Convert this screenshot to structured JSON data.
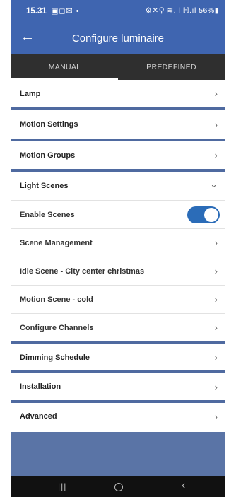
{
  "status_bar": {
    "time": "15.31",
    "left_icons": "▣◻✉ •",
    "right_icons": "⚙✕⚲ ≋.ıl ℍ.ıl 56%▮"
  },
  "app_bar": {
    "back_icon": "arrow-left-icon",
    "back_glyph": "←",
    "title": "Configure luminaire"
  },
  "tabs": [
    {
      "label": "MANUAL",
      "selected": true
    },
    {
      "label": "PREDEFINED",
      "selected": false
    }
  ],
  "rows": {
    "lamp": "Lamp",
    "motion_settings": "Motion Settings",
    "motion_groups": "Motion Groups",
    "light_scenes": "Light Scenes",
    "enable_scenes": "Enable Scenes",
    "scene_management": "Scene Management",
    "idle_scene": "Idle Scene - City center christmas",
    "motion_scene": "Motion Scene - cold",
    "configure_channels": "Configure Channels",
    "dimming_schedule": "Dimming Schedule",
    "installation": "Installation",
    "advanced": "Advanced"
  },
  "glyphs": {
    "chevron_right": "›",
    "chevron_down": "⌄"
  },
  "enable_scenes_on": true,
  "colors": {
    "app_bar": "#3f65b0",
    "tab_bar": "#2f2f2f",
    "toggle": "#2b6cb8",
    "separator": "#4f6aa0"
  },
  "nav_bar": {
    "recents_glyph": "|||",
    "back_glyph": "‹"
  }
}
